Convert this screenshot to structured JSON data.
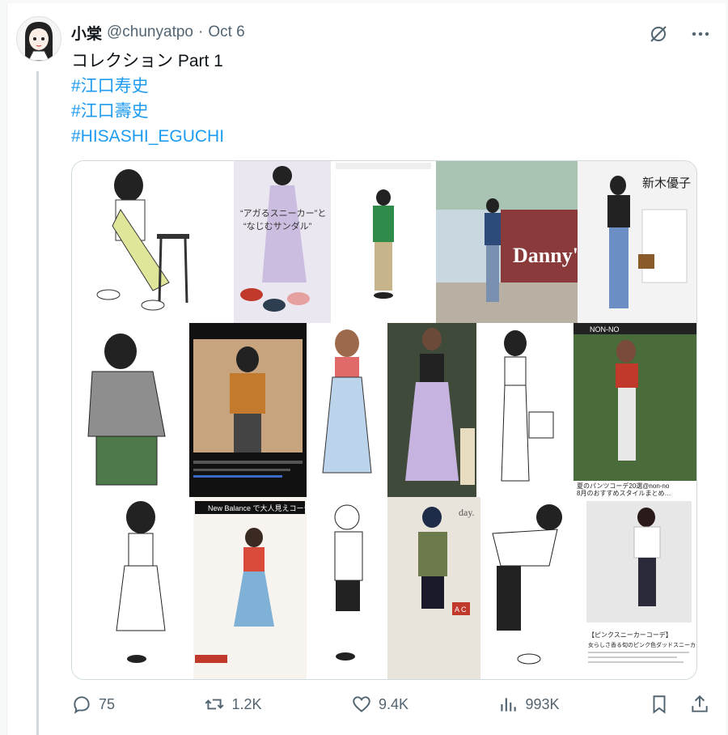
{
  "tweet": {
    "display_name": "小棠",
    "handle": "@chunyatpo",
    "separator": "·",
    "date": "Oct 6",
    "title_line": "コレクション Part 1",
    "hashtags": [
      "#江口寿史",
      "#江口壽史",
      "#HISASHI_EGUCHI"
    ]
  },
  "media_text": {
    "speech_1": "“アガるスニーカー”と",
    "speech_2": "“なじむサンダル”",
    "new_balance": "New Balance で大人見えコーデ！",
    "dannys": "Danny's",
    "name_card": "新木優子",
    "nonno": "NON-NO",
    "nonno_caption": "夏のパンツコーデ20選@non-no",
    "nonno_caption2": "8月のおすすめスタイルまとめ…",
    "day": "day.",
    "ac": "A C",
    "pink_sneaker": "【ピンクスニーカーコーデ】",
    "pink_sneaker_2": "女らしさ香る旬のピンク色ダッドスニーカー"
  },
  "actions": {
    "replies": "75",
    "retweets": "1.2K",
    "likes": "9.4K",
    "views": "993K"
  },
  "colors": {
    "accent": "#1d9bf0",
    "text": "#0f1419",
    "muted": "#536471"
  }
}
